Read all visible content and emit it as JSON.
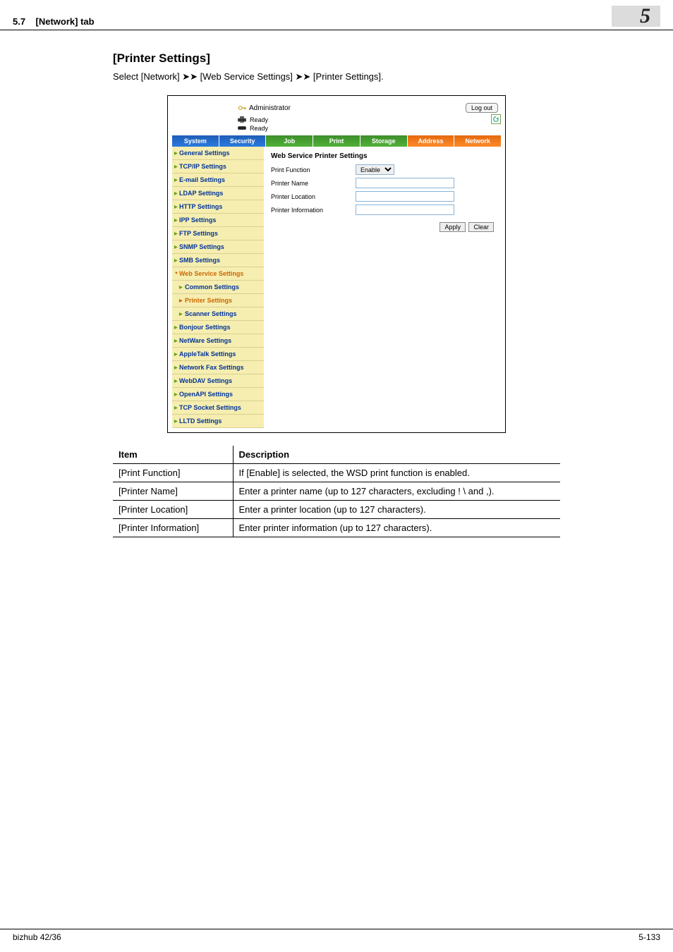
{
  "header": {
    "section_ref": "5.7",
    "tab_name": "[Network] tab",
    "chapter_num": "5"
  },
  "page": {
    "title": "[Printer Settings]",
    "instruction": "Select [Network] ➤➤ [Web Service Settings] ➤➤ [Printer Settings]."
  },
  "app": {
    "user_label": "Administrator",
    "logout": "Log out",
    "status1": "Ready",
    "status2": "Ready",
    "tabs": [
      "System",
      "Security",
      "Job",
      "Print",
      "Storage",
      "Address",
      "Network"
    ],
    "sidebar": {
      "items": [
        "General Settings",
        "TCP/IP Settings",
        "E-mail Settings",
        "LDAP Settings",
        "HTTP Settings",
        "IPP Settings",
        "FTP Settings",
        "SNMP Settings",
        "SMB Settings"
      ],
      "expanded_label": "Web Service Settings",
      "subitems": [
        "Common Settings",
        "Printer Settings",
        "Scanner Settings"
      ],
      "items_after": [
        "Bonjour Settings",
        "NetWare Settings",
        "AppleTalk Settings",
        "Network Fax Settings",
        "WebDAV Settings",
        "OpenAPI Settings",
        "TCP Socket Settings",
        "LLTD Settings"
      ]
    },
    "pane": {
      "title": "Web Service Printer Settings",
      "rows": {
        "print_function": "Print Function",
        "printer_name": "Printer Name",
        "printer_location": "Printer Location",
        "printer_information": "Printer Information"
      },
      "select_value": "Enable",
      "apply": "Apply",
      "clear": "Clear"
    }
  },
  "table": {
    "head_item": "Item",
    "head_desc": "Description",
    "rows": [
      {
        "item": "[Print Function]",
        "desc": "If [Enable] is selected, the WSD print function is enabled."
      },
      {
        "item": "[Printer Name]",
        "desc": "Enter a printer name (up to 127 characters, excluding ! \\ and ,)."
      },
      {
        "item": "[Printer Location]",
        "desc": "Enter a printer location (up to 127 characters)."
      },
      {
        "item": "[Printer Information]",
        "desc": "Enter printer information (up to 127 characters)."
      }
    ]
  },
  "footer": {
    "model": "bizhub 42/36",
    "page_num": "5-133"
  }
}
